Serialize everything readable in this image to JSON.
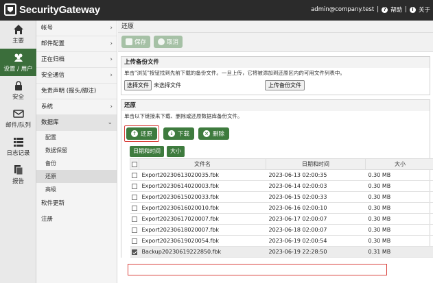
{
  "app": {
    "title": "SecurityGateway"
  },
  "topbar": {
    "user": "admin@company.test",
    "help": "帮助",
    "about": "关于"
  },
  "leftnav": [
    {
      "label": "主要",
      "icon": "home-icon"
    },
    {
      "label": "设置 / 用户",
      "icon": "users-icon",
      "active": true
    },
    {
      "label": "安全",
      "icon": "lock-icon"
    },
    {
      "label": "邮件/队列",
      "icon": "mail-icon"
    },
    {
      "label": "日志记录",
      "icon": "list-icon"
    },
    {
      "label": "报告",
      "icon": "report-icon"
    }
  ],
  "subnav": {
    "items": [
      "帐号",
      "邮件配置",
      "正在归档",
      "安全通信",
      "免责声明 (报头/脚注)",
      "系统",
      "数据库"
    ],
    "children": [
      "配置",
      "数据保留",
      "备份",
      "还原",
      "高级"
    ],
    "extra": [
      "软件更新",
      "注册"
    ]
  },
  "breadcrumb": "还原",
  "toolbar": {
    "save": "保存",
    "cancel": "取消"
  },
  "upload": {
    "title": "上传备份文件",
    "desc": "单击\"浏览\"按钮找到先前下载的备份文件。一旦上传，它将被添加到还原区内的可用文件列表中。",
    "choose": "选择文件",
    "nofile": "未选择文件",
    "upload_btn": "上传备份文件"
  },
  "restore": {
    "title": "还原",
    "desc": "单击以下链接来下载、删除或还原数据库备份文件。",
    "restore_btn": "还原",
    "download_btn": "下载",
    "delete_btn": "删除",
    "sort_date": "日期和时间",
    "sort_size": "大小"
  },
  "table": {
    "headers": {
      "filename": "文件名",
      "datetime": "日期和时间",
      "size": "大小"
    },
    "rows": [
      {
        "name": "Export20230613020035.fbk",
        "date": "2023-06-13 02:00:35",
        "size": "0.30 MB"
      },
      {
        "name": "Export20230614020003.fbk",
        "date": "2023-06-14 02:00:03",
        "size": "0.30 MB"
      },
      {
        "name": "Export20230615020033.fbk",
        "date": "2023-06-15 02:00:33",
        "size": "0.30 MB"
      },
      {
        "name": "Export20230616020010.fbk",
        "date": "2023-06-16 02:00:10",
        "size": "0.30 MB"
      },
      {
        "name": "Export20230617020007.fbk",
        "date": "2023-06-17 02:00:07",
        "size": "0.30 MB"
      },
      {
        "name": "Export20230618020007.fbk",
        "date": "2023-06-18 02:00:07",
        "size": "0.30 MB"
      },
      {
        "name": "Export20230619020054.fbk",
        "date": "2023-06-19 02:00:54",
        "size": "0.30 MB"
      },
      {
        "name": "Backup20230619222850.fbk",
        "date": "2023-06-19 22:28:50",
        "size": "0.31 MB",
        "checked": true
      }
    ]
  }
}
